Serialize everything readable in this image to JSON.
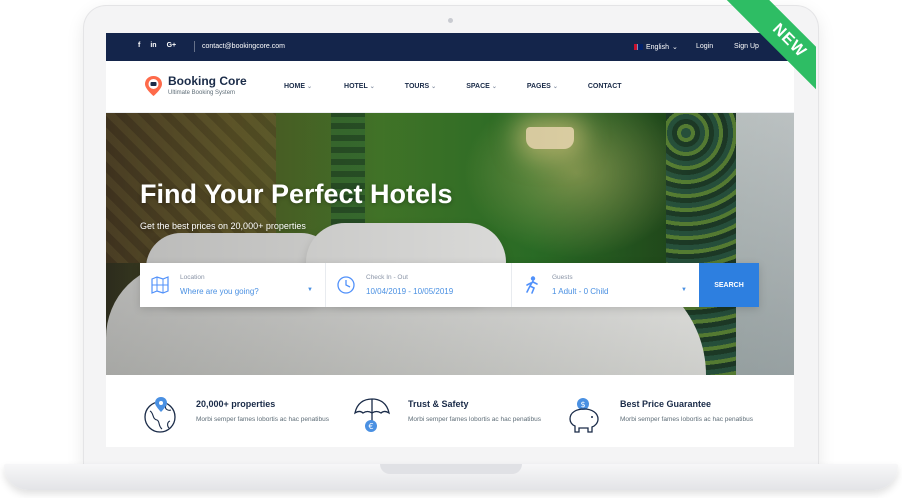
{
  "topbar": {
    "social": [
      "f",
      "in",
      "G+"
    ],
    "email": "contact@bookingcore.com",
    "language": "English",
    "login": "Login",
    "signup": "Sign Up"
  },
  "brand": {
    "title": "Booking Core",
    "tagline": "Ultimate Booking System",
    "accent": "#fe6a4a"
  },
  "menu": [
    {
      "label": "HOME",
      "has_dropdown": true
    },
    {
      "label": "HOTEL",
      "has_dropdown": true
    },
    {
      "label": "TOURS",
      "has_dropdown": true
    },
    {
      "label": "SPACE",
      "has_dropdown": true
    },
    {
      "label": "PAGES",
      "has_dropdown": true
    },
    {
      "label": "CONTACT",
      "has_dropdown": false
    }
  ],
  "hero": {
    "title": "Find Your Perfect Hotels",
    "subtitle": "Get the best prices on 20,000+ properties"
  },
  "search": {
    "location": {
      "label": "Location",
      "value": "Where are you going?",
      "icon": "map-icon"
    },
    "dates": {
      "label": "Check In - Out",
      "value": "10/04/2019 - 10/05/2019",
      "icon": "clock-icon"
    },
    "guests": {
      "label": "Guests",
      "value": "1 Adult - 0 Child",
      "icon": "person-icon"
    },
    "button": "SEARCH",
    "button_color": "#2d7fe0"
  },
  "features": [
    {
      "title": "20,000+ properties",
      "desc": "Morbi semper fames lobortis ac hac penatibus",
      "icon": "globe-pin-icon"
    },
    {
      "title": "Trust & Safety",
      "desc": "Morbi semper fames lobortis ac hac penatibus",
      "icon": "umbrella-icon"
    },
    {
      "title": "Best Price Guarantee",
      "desc": "Morbi semper fames lobortis ac hac penatibus",
      "icon": "piggy-bank-icon"
    }
  ],
  "ribbon": {
    "label": "NEW",
    "color": "#2ebd64"
  },
  "colors": {
    "topbar": "#14254b",
    "text_dark": "#1a2b48",
    "link_blue": "#4a90e2"
  }
}
